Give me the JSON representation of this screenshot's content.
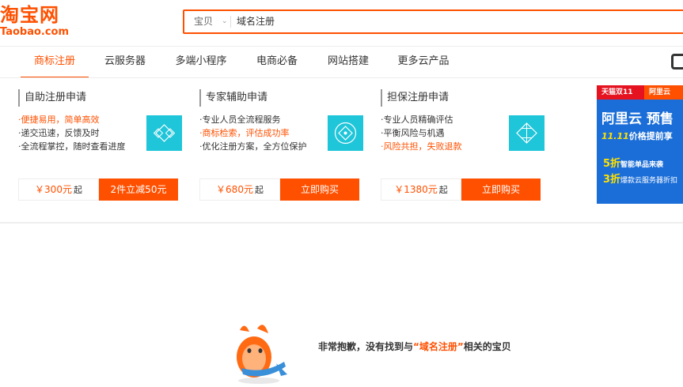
{
  "logo": {
    "cn": "淘宝网",
    "en": "Taobao.com"
  },
  "search": {
    "category": "宝贝",
    "query": "域名注册"
  },
  "tabs": [
    {
      "label": "商标注册",
      "active": true
    },
    {
      "label": "云服务器",
      "active": false
    },
    {
      "label": "多端小程序",
      "active": false
    },
    {
      "label": "电商必备",
      "active": false
    },
    {
      "label": "网站搭建",
      "active": false
    },
    {
      "label": "更多云产品",
      "active": false
    }
  ],
  "cards": [
    {
      "title": "自助注册申请",
      "features": [
        {
          "text": "便捷易用，简单高效",
          "highlight": true
        },
        {
          "text": "递交迅速，反馈及时",
          "highlight": false
        },
        {
          "text": "全流程掌控，随时查看进度",
          "highlight": false
        }
      ],
      "price": "￥300元",
      "price_suffix": "起",
      "button": "2件立减50元"
    },
    {
      "title": "专家辅助申请",
      "features": [
        {
          "text": "专业人员全流程服务",
          "highlight": false
        },
        {
          "text": "商标检索，评估成功率",
          "highlight": true
        },
        {
          "text": "优化注册方案，全方位保护",
          "highlight": false
        }
      ],
      "price": "￥680元",
      "price_suffix": "起",
      "button": "立即购买"
    },
    {
      "title": "担保注册申请",
      "features": [
        {
          "text": "专业人员精确评估",
          "highlight": false
        },
        {
          "text": "平衡风险与机遇",
          "highlight": false
        },
        {
          "text": "风险共担，失败退款",
          "highlight": true
        }
      ],
      "price": "￥1380元",
      "price_suffix": "起",
      "button": "立即购买"
    }
  ],
  "ad": {
    "tmall": "天猫双11",
    "aliyun": "阿里云",
    "line1": "阿里云 预售",
    "line2_a": "11.11",
    "line2_b": "价格提前享",
    "line3_a": "5折",
    "line3_b": "智能单品来袭",
    "line4_a": "3折",
    "line4_b": "爆款云服务器折扣"
  },
  "empty": {
    "before": "非常抱歉，没有找到与",
    "keyword": "“域名注册”",
    "after": "相关的宝贝"
  },
  "colors": {
    "brand": "#ff5000",
    "icon_bg": "#1fc5d9",
    "ad_bg": "#1b6ed8"
  }
}
